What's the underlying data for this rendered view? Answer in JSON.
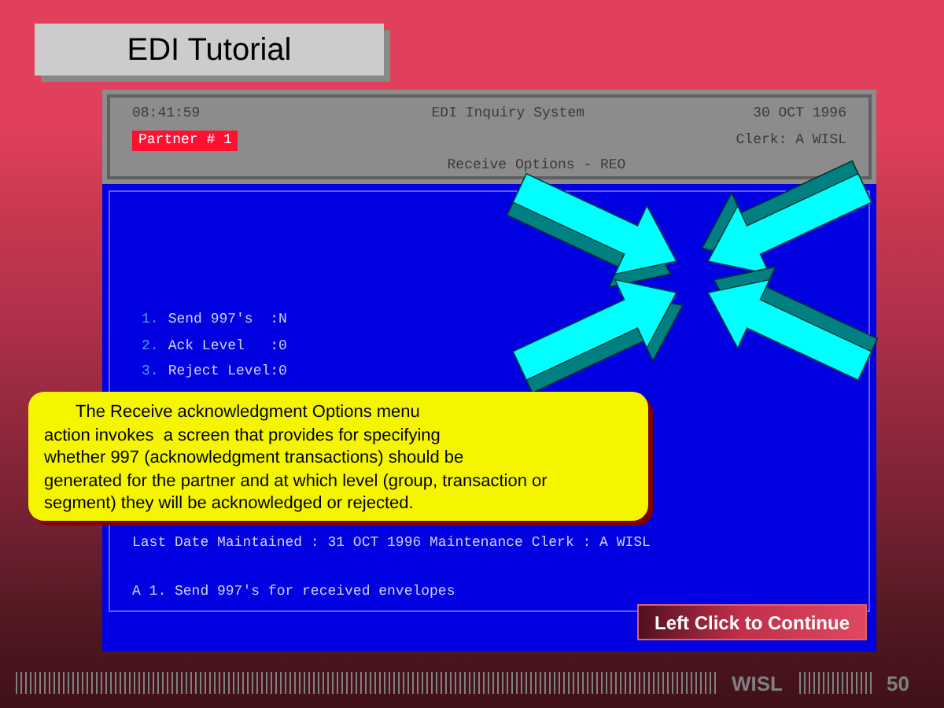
{
  "title": "EDI Tutorial",
  "terminal": {
    "time": "08:41:59",
    "system_name": "EDI Inquiry System",
    "date": "30 OCT 1996",
    "partner": "Partner # 1",
    "clerk": "Clerk: A WISL",
    "screen_title": "Receive Options - REO",
    "menu": [
      {
        "number": "1.",
        "label": "Send 997's  :N"
      },
      {
        "number": "2.",
        "label": "Ack Level   :0"
      },
      {
        "number": "3.",
        "label": "Reject Level:0"
      }
    ],
    "last_maintained": "Last Date Maintained : 31 OCT 1996 Maintenance Clerk : A WISL",
    "action_line": "A 1. Send 997's for received envelopes"
  },
  "callout": {
    "lines": [
      "The Receive acknowledgment Options menu",
      "action invokes  a screen that provides for specifying",
      "whether 997 (acknowledgment transactions) should be",
      "generated for the partner and at which level (group, transaction or",
      "segment) they will be acknowledged or rejected."
    ]
  },
  "continue_button": "Left Click to Continue",
  "footer": {
    "brand": "WISL",
    "page": "50"
  }
}
